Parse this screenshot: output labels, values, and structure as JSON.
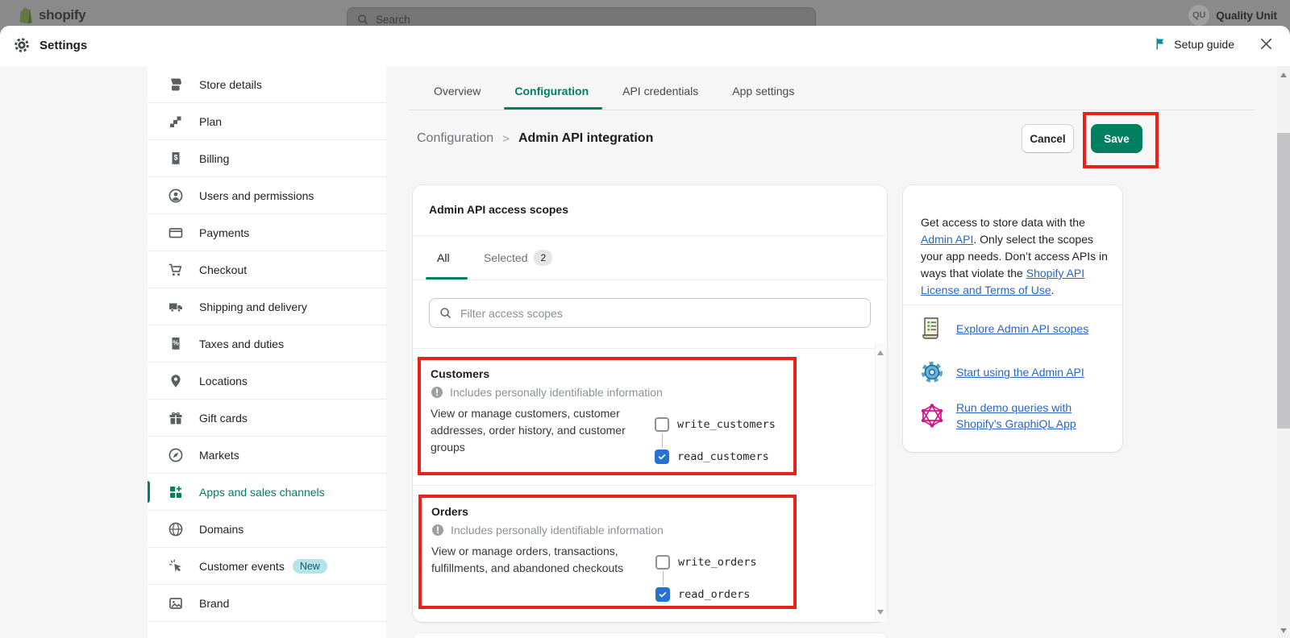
{
  "topbar": {
    "brand": "shopify",
    "search_placeholder": "Search",
    "user_initials": "QU",
    "user_name": "Quality Unit"
  },
  "modal_header": {
    "title": "Settings",
    "setup_guide": "Setup guide"
  },
  "sidebar": {
    "items": [
      {
        "label": "Store details"
      },
      {
        "label": "Plan"
      },
      {
        "label": "Billing"
      },
      {
        "label": "Users and permissions"
      },
      {
        "label": "Payments"
      },
      {
        "label": "Checkout"
      },
      {
        "label": "Shipping and delivery"
      },
      {
        "label": "Taxes and duties"
      },
      {
        "label": "Locations"
      },
      {
        "label": "Gift cards"
      },
      {
        "label": "Markets"
      },
      {
        "label": "Apps and sales channels",
        "active": true
      },
      {
        "label": "Domains"
      },
      {
        "label": "Customer events",
        "badge": "New"
      },
      {
        "label": "Brand"
      }
    ]
  },
  "tabs": {
    "items": [
      {
        "label": "Overview"
      },
      {
        "label": "Configuration",
        "active": true
      },
      {
        "label": "API credentials"
      },
      {
        "label": "App settings"
      }
    ]
  },
  "breadcrumb": {
    "parent": "Configuration",
    "separator": ">",
    "current": "Admin API integration"
  },
  "actions": {
    "cancel": "Cancel",
    "save": "Save"
  },
  "scopes_card": {
    "title": "Admin API access scopes",
    "tab_all": "All",
    "tab_selected": "Selected",
    "selected_count": "2",
    "filter_placeholder": "Filter access scopes",
    "sections": [
      {
        "title": "Customers",
        "pii_note": "Includes personally identifiable information",
        "description": "View or manage customers, customer addresses, order history, and customer groups",
        "checkboxes": [
          {
            "label": "write_customers",
            "checked": false
          },
          {
            "label": "read_customers",
            "checked": true
          }
        ]
      },
      {
        "title": "Orders",
        "pii_note": "Includes personally identifiable information",
        "description": "View or manage orders, transactions, fulfillments, and abandoned checkouts",
        "checkboxes": [
          {
            "label": "write_orders",
            "checked": false
          },
          {
            "label": "read_orders",
            "checked": true
          }
        ]
      }
    ]
  },
  "side_panel": {
    "text_1": "Get access to store data with the ",
    "link_1": "Admin API",
    "text_2": ". Only select the scopes your app needs. Don’t access APIs in ways that violate the ",
    "link_2": "Shopify API License and Terms of Use",
    "text_3": ".",
    "links": [
      {
        "label": "Explore Admin API scopes",
        "icon": "scroll-icon"
      },
      {
        "label": "Start using the Admin API",
        "icon": "gear-icon"
      },
      {
        "label": "Run demo queries with Shopify’s GraphiQL App",
        "icon": "graphql-icon"
      }
    ]
  },
  "colors": {
    "accent_green": "#008060",
    "link_blue": "#2a66c7",
    "annotation_red": "#e8221a",
    "checkbox_blue": "#2472d2",
    "badge_teal_bg": "#b5e3e8"
  }
}
